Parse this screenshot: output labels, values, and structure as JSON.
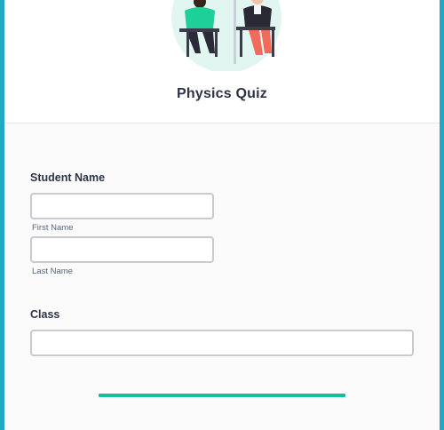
{
  "form": {
    "title": "Physics Quiz",
    "accent_color": "#1fa9c5",
    "progress_color": "#18bd9b",
    "progress": 1.0
  },
  "header": {
    "image_icon": "students-studying-illustration-icon"
  },
  "student_name": {
    "label": "Student Name",
    "first_name": {
      "value": "",
      "sublabel": "First Name"
    },
    "last_name": {
      "value": "",
      "sublabel": "Last Name"
    }
  },
  "class_field": {
    "label": "Class",
    "value": ""
  }
}
